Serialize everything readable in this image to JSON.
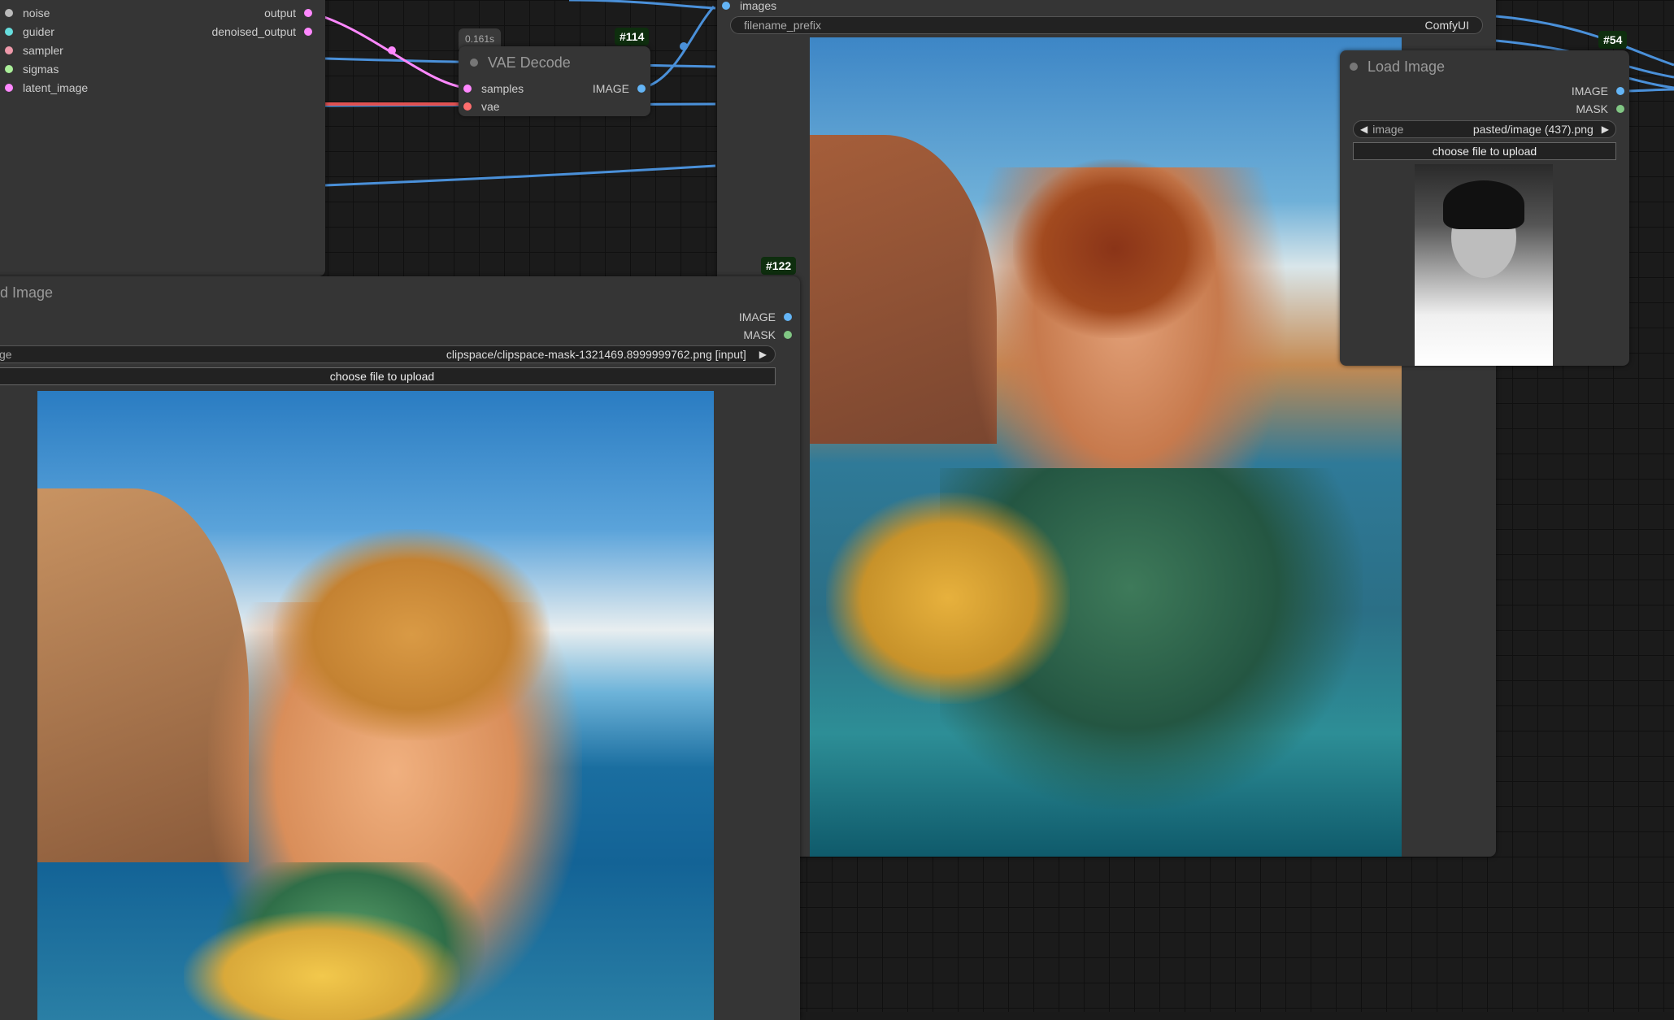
{
  "sampler_node": {
    "inputs": [
      "noise",
      "guider",
      "sampler",
      "sigmas",
      "latent_image"
    ],
    "outputs": [
      "output",
      "denoised_output"
    ]
  },
  "vae_decode_node": {
    "badge": "#114",
    "timing": "0.161s",
    "title": "VAE Decode",
    "inputs": [
      "samples",
      "vae"
    ],
    "output": "IMAGE"
  },
  "save_image_node": {
    "input": "images",
    "widget_label": "filename_prefix",
    "widget_value": "ComfyUI"
  },
  "load_image_left": {
    "badge": "#122",
    "title": "d Image",
    "outputs": [
      "IMAGE",
      "MASK"
    ],
    "image_label": "ge",
    "image_value": "clipspace/clipspace-mask-1321469.8999999762.png [input]",
    "upload_label": "choose file to upload"
  },
  "load_image_right": {
    "badge": "#54",
    "title": "Load Image",
    "outputs": [
      "IMAGE",
      "MASK"
    ],
    "image_label": "image",
    "image_value": "pasted/image (437).png",
    "upload_label": "choose file to upload"
  },
  "icons": {
    "arrow_left": "◀",
    "arrow_right": "▶"
  },
  "colors": {
    "noise": "#bbbbbb",
    "guider": "#66dddd",
    "sampler": "#ee99aa",
    "sigmas": "#aaee99",
    "latent": "#ff88ff",
    "image": "#64b5f6",
    "mask": "#81c784",
    "vae": "#ff6e6e",
    "wire_blue": "#4a90d9"
  }
}
